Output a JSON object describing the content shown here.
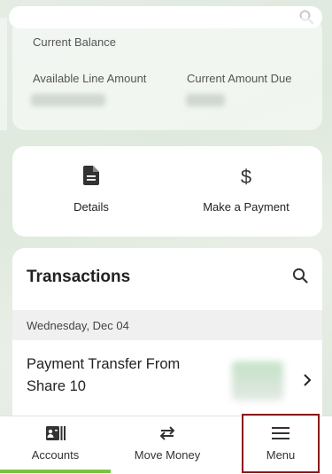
{
  "search": {
    "placeholder": ""
  },
  "balance": {
    "current_balance_label": "Current Balance",
    "available_line_label": "Available Line Amount",
    "current_amount_due_label": "Current Amount Due"
  },
  "actions": [
    {
      "label": "Details",
      "icon": "document-icon"
    },
    {
      "label": "Make a Payment",
      "icon": "dollar-icon"
    }
  ],
  "transactions": {
    "title": "Transactions",
    "date_header": "Wednesday, Dec 04",
    "items": [
      {
        "name": "Payment Transfer From Share 10"
      }
    ]
  },
  "nav": {
    "items": [
      {
        "label": "Accounts",
        "icon": "accounts-card-icon",
        "active": true
      },
      {
        "label": "Move Money",
        "icon": "transfer-arrows-icon",
        "active": false
      },
      {
        "label": "Menu",
        "icon": "hamburger-menu-icon",
        "active": false
      }
    ]
  },
  "colors": {
    "accent": "#7cc242",
    "highlight_border": "#8b1a1a"
  }
}
